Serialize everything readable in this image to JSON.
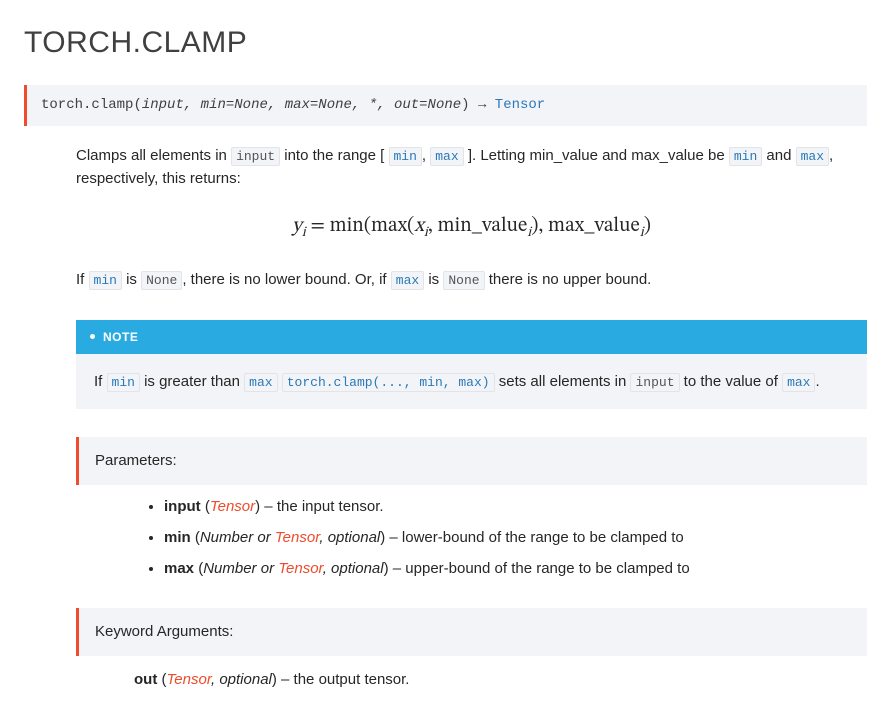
{
  "title": "TORCH.CLAMP",
  "signature": {
    "module": "torch.",
    "func": "clamp",
    "args_pre": "(",
    "arg1": "input",
    "sep1": ", ",
    "arg2": "min=None",
    "sep2": ", ",
    "arg3": "max=None",
    "sep3": ", ",
    "star": "*",
    "sep4": ", ",
    "arg4": "out=None",
    "args_post": ")",
    "arrow": " → ",
    "return_type": "Tensor"
  },
  "desc1_a": "Clamps all elements in ",
  "desc1_chip1": "input",
  "desc1_b": " into the range ",
  "desc1_lb": "[ ",
  "desc1_chip2": "min",
  "desc1_comma": ", ",
  "desc1_chip3": "max",
  "desc1_rb": " ]",
  "desc1_c": ". Letting min_value and max_value be ",
  "desc1_chip4": "min",
  "desc1_d": " and ",
  "desc1_chip5": "max",
  "desc1_e": ", respectively, this returns:",
  "formula": {
    "y": "y",
    "i1": "i",
    "eq": " = min(max(",
    "x": "x",
    "i2": "i",
    "c1": ", min_value",
    "i3": "i",
    "c2": "), max_value",
    "i4": "i",
    "c3": ")"
  },
  "desc2_a": "If ",
  "desc2_chip1": "min",
  "desc2_b": " is ",
  "desc2_chip2": "None",
  "desc2_c": ", there is no lower bound. Or, if ",
  "desc2_chip3": "max",
  "desc2_d": " is ",
  "desc2_chip4": "None",
  "desc2_e": " there is no upper bound.",
  "note": {
    "label": "NOTE",
    "a": "If ",
    "chip1": "min",
    "b": " is greater than ",
    "chip2": "max",
    "space": " ",
    "chip3": "torch.clamp(..., min, max)",
    "c": " sets all elements in ",
    "chip4": "input",
    "d": " to the value of ",
    "chip5": "max",
    "e": "."
  },
  "parameters_label": "Parameters:",
  "params": {
    "p0_name": "input",
    "p0_lp": " (",
    "p0_type": "Tensor",
    "p0_rp": ")",
    "p0_desc": " – the input tensor.",
    "p1_name": "min",
    "p1_lp": " (",
    "p1_type_a": "Number or ",
    "p1_type_b": "Tensor",
    "p1_type_c": ", optional",
    "p1_rp": ")",
    "p1_desc": " – lower-bound of the range to be clamped to",
    "p2_name": "max",
    "p2_lp": " (",
    "p2_type_a": "Number or ",
    "p2_type_b": "Tensor",
    "p2_type_c": ", optional",
    "p2_rp": ")",
    "p2_desc": " – upper-bound of the range to be clamped to"
  },
  "kwargs_label": "Keyword Arguments:",
  "kwargs": {
    "k0_name": "out",
    "k0_lp": " (",
    "k0_type_a": "Tensor",
    "k0_type_b": ", optional",
    "k0_rp": ")",
    "k0_desc": " – the output tensor."
  }
}
